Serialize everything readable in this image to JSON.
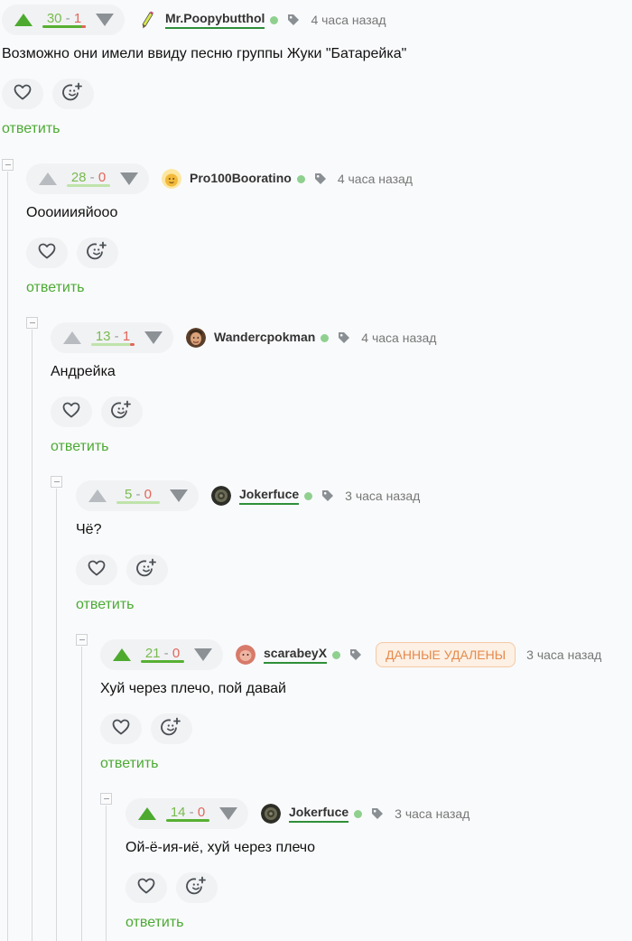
{
  "comments": [
    {
      "id": "c1",
      "vote_active": true,
      "plus": "30",
      "sep": " - ",
      "minus": "1",
      "bar_strong": true,
      "bar_neg": true,
      "username": "Mr.Poopybutthol",
      "underlined": true,
      "online": true,
      "badge": "",
      "time": "4 часа назад",
      "text": "Возможно они имели ввиду песню группы Жуки \"Батарейка\"",
      "reply": "ответить",
      "avatar": "pencil"
    },
    {
      "id": "c2",
      "vote_active": false,
      "plus": "28",
      "sep": " - ",
      "minus": "0",
      "bar_strong": false,
      "bar_neg": false,
      "username": "Pro100Booratino",
      "underlined": false,
      "online": true,
      "badge": "",
      "time": "4 часа назад",
      "text": "Оооииияйоoo",
      "reply": "ответить",
      "avatar": "yellow"
    },
    {
      "id": "c3",
      "vote_active": false,
      "plus": "13",
      "sep": " - ",
      "minus": "1",
      "bar_strong": false,
      "bar_neg": true,
      "username": "Wandercpokman",
      "underlined": false,
      "online": true,
      "badge": "",
      "time": "4 часа назад",
      "text": "Андрейка",
      "reply": "ответить",
      "avatar": "face"
    },
    {
      "id": "c4",
      "vote_active": false,
      "plus": "5",
      "sep": " - ",
      "minus": "0",
      "bar_strong": false,
      "bar_neg": false,
      "username": "Jokerfuce",
      "underlined": true,
      "online": true,
      "badge": "",
      "time": "3 часа назад",
      "text": "Чё?",
      "reply": "ответить",
      "avatar": "dark"
    },
    {
      "id": "c5",
      "vote_active": true,
      "plus": "21",
      "sep": " - ",
      "minus": "0",
      "bar_strong": true,
      "bar_neg": false,
      "username": "scarabeyX",
      "underlined": true,
      "online": true,
      "badge": "ДАННЫЕ УДАЛЕНЫ",
      "time": "3 часа назад",
      "text": "Хуй через плечо, пой давай",
      "reply": "ответить",
      "avatar": "pink"
    },
    {
      "id": "c6",
      "vote_active": true,
      "plus": "14",
      "sep": " - ",
      "minus": "0",
      "bar_strong": true,
      "bar_neg": false,
      "username": "Jokerfuce",
      "underlined": true,
      "online": true,
      "badge": "",
      "time": "3 часа назад",
      "text": "Ой-ё-ия-иё, хуй через плечо",
      "reply": "ответить",
      "avatar": "dark"
    }
  ],
  "colors": {
    "green": "#4daa2f",
    "red": "#e2665a",
    "badge_orange": "#e58a4c",
    "online": "#8fd08f"
  }
}
